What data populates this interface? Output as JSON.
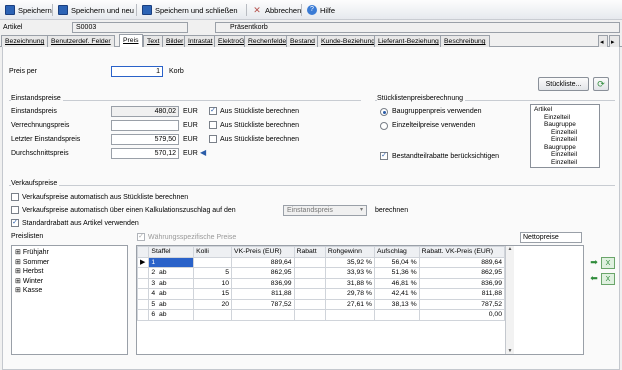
{
  "toolbar": {
    "save": "Speichern",
    "save_new": "Speichern und neu",
    "save_close": "Speichern und schließen",
    "cancel": "Abbrechen",
    "help": "Hilfe"
  },
  "article": {
    "label": "Artikel",
    "number": "S0003",
    "name": "Präsentkorb"
  },
  "tabs": [
    "Bezeichnung",
    "Benutzerdef. Felder",
    "Preis",
    "Text",
    "Bilder",
    "Intrastat",
    "ElektroG",
    "Rechenfelder",
    "Bestand",
    "Kunde-Beziehung",
    "Lieferant-Beziehung",
    "Beschreibung"
  ],
  "price_per": {
    "label": "Preis per",
    "value": "1",
    "unit": "Korb"
  },
  "stueckliste_button": "Stückliste...",
  "einstand": {
    "title": "Einstandspreise",
    "rows": [
      {
        "label": "Einstandspreis",
        "value": "480,02",
        "cur": "EUR",
        "chk": "Aus Stückliste berechnen",
        "checked": "true"
      },
      {
        "label": "Verrechnungspreis",
        "value": "",
        "cur": "EUR",
        "chk": "Aus Stückliste berechnen",
        "checked": "false"
      },
      {
        "label": "Letzter Einstandspreis",
        "value": "579,50",
        "cur": "EUR",
        "chk": "Aus Stückliste berechnen",
        "checked": "false"
      },
      {
        "label": "Durchschnittspreis",
        "value": "570,12",
        "cur": "EUR",
        "chk": "",
        "checked": "false"
      }
    ]
  },
  "stl": {
    "title": "Stücklistenpreisberechnung",
    "radio1": "Baugruppenpreis verwenden",
    "radio2": "Einzelteilpreise verwenden",
    "chk": "Bestandteilrabatte berücksichtigen",
    "tree": [
      "Artikel",
      "Einzelteil",
      "Baugruppe",
      "Einzelteil",
      "Einzelteil",
      "Baugruppe",
      "Einzelteil",
      "Einzelteil"
    ]
  },
  "vk": {
    "title": "Verkaufspreise",
    "opt1": "Verkaufspreise automatisch aus Stückliste berechnen",
    "opt2": "Verkaufspreise automatisch über einen Kalkulationszuschlag auf den",
    "opt2_select": "Einstandspreis",
    "opt2_suffix": "berechnen",
    "opt3": "Standardrabatt aus Artikel verwenden",
    "preislisten_label": "Preislisten",
    "currency_chk": "Währungsspezifische Preise",
    "netto_label": "Nettopreise",
    "lists": [
      "Frühjahr",
      "Sommer",
      "Herbst",
      "Winter",
      "Kasse"
    ]
  },
  "table": {
    "headers": [
      "Staffel",
      "Kolli",
      "VK-Preis (EUR)",
      "Rabatt",
      "Rohgewinn",
      "Aufschlag",
      "Rabatt. VK-Preis (EUR)"
    ],
    "rows": [
      {
        "staffel": "1",
        "ab": "",
        "kolli": "",
        "vk": "889,64",
        "rabatt": "",
        "roh": "35,92 %",
        "auf": "56,04 %",
        "rvk": "889,64"
      },
      {
        "staffel": "2",
        "ab": "ab",
        "kolli": "5",
        "vk": "862,95",
        "rabatt": "",
        "roh": "33,93 %",
        "auf": "51,36 %",
        "rvk": "862,95"
      },
      {
        "staffel": "3",
        "ab": "ab",
        "kolli": "10",
        "vk": "836,99",
        "rabatt": "",
        "roh": "31,88 %",
        "auf": "46,81 %",
        "rvk": "836,99"
      },
      {
        "staffel": "4",
        "ab": "ab",
        "kolli": "15",
        "vk": "811,88",
        "rabatt": "",
        "roh": "29,78 %",
        "auf": "42,41 %",
        "rvk": "811,88"
      },
      {
        "staffel": "5",
        "ab": "ab",
        "kolli": "20",
        "vk": "787,52",
        "rabatt": "",
        "roh": "27,61 %",
        "auf": "38,13 %",
        "rvk": "787,52"
      },
      {
        "staffel": "6",
        "ab": "ab",
        "kolli": "",
        "vk": "",
        "rabatt": "",
        "roh": "",
        "auf": "",
        "rvk": "0,00"
      }
    ]
  }
}
